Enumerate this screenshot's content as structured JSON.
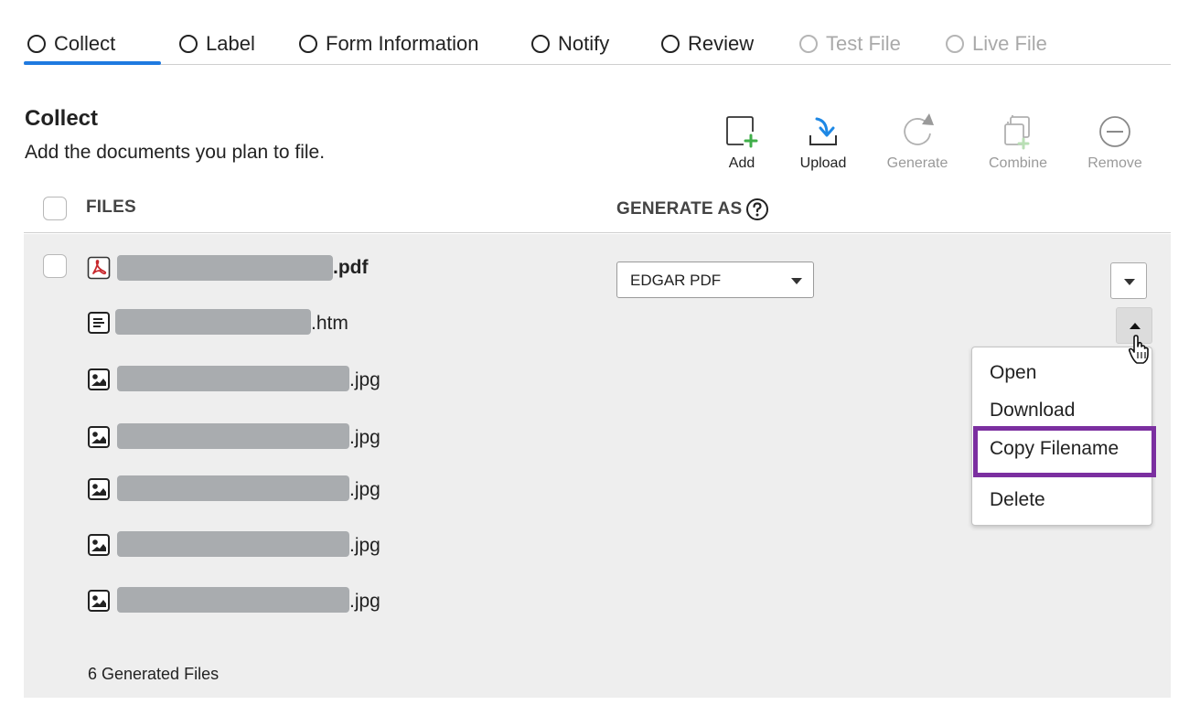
{
  "steps": [
    {
      "label": "Collect",
      "state": "active"
    },
    {
      "label": "Label",
      "state": "enabled"
    },
    {
      "label": "Form Information",
      "state": "enabled"
    },
    {
      "label": "Notify",
      "state": "enabled"
    },
    {
      "label": "Review",
      "state": "enabled"
    },
    {
      "label": "Test File",
      "state": "disabled"
    },
    {
      "label": "Live File",
      "state": "disabled"
    }
  ],
  "header": {
    "title": "Collect",
    "subtitle": "Add the documents you plan to file."
  },
  "toolbar": {
    "add": {
      "label": "Add",
      "icon": "add-document-icon",
      "enabled": true
    },
    "upload": {
      "label": "Upload",
      "icon": "upload-icon",
      "enabled": true
    },
    "generate": {
      "label": "Generate",
      "icon": "refresh-icon",
      "enabled": false
    },
    "combine": {
      "label": "Combine",
      "icon": "combine-icon",
      "enabled": false
    },
    "remove": {
      "label": "Remove",
      "icon": "minus-circle-icon",
      "enabled": false
    }
  },
  "table": {
    "columns": {
      "files": "FILES",
      "generate_as": "GENERATE AS"
    },
    "primary_file": {
      "extension": ".pdf",
      "icon": "pdf-icon",
      "generate_as": "EDGAR PDF"
    },
    "generated_files": [
      {
        "extension": ".htm",
        "icon": "text-file-icon"
      },
      {
        "extension": ".jpg",
        "icon": "image-file-icon"
      },
      {
        "extension": ".jpg",
        "icon": "image-file-icon"
      },
      {
        "extension": ".jpg",
        "icon": "image-file-icon"
      },
      {
        "extension": ".jpg",
        "icon": "image-file-icon"
      },
      {
        "extension": ".jpg",
        "icon": "image-file-icon"
      }
    ],
    "footer": "6 Generated Files"
  },
  "context_menu": {
    "items": [
      "Open",
      "Download",
      "Copy Filename",
      "Delete"
    ],
    "highlighted": "Copy Filename"
  },
  "colors": {
    "accent": "#1f7ae0",
    "highlight": "#7b2fa0",
    "pdf_red": "#c8282d",
    "add_green": "#3fae49",
    "upload_blue": "#1e88e5",
    "redaction": "#a9acaf"
  }
}
